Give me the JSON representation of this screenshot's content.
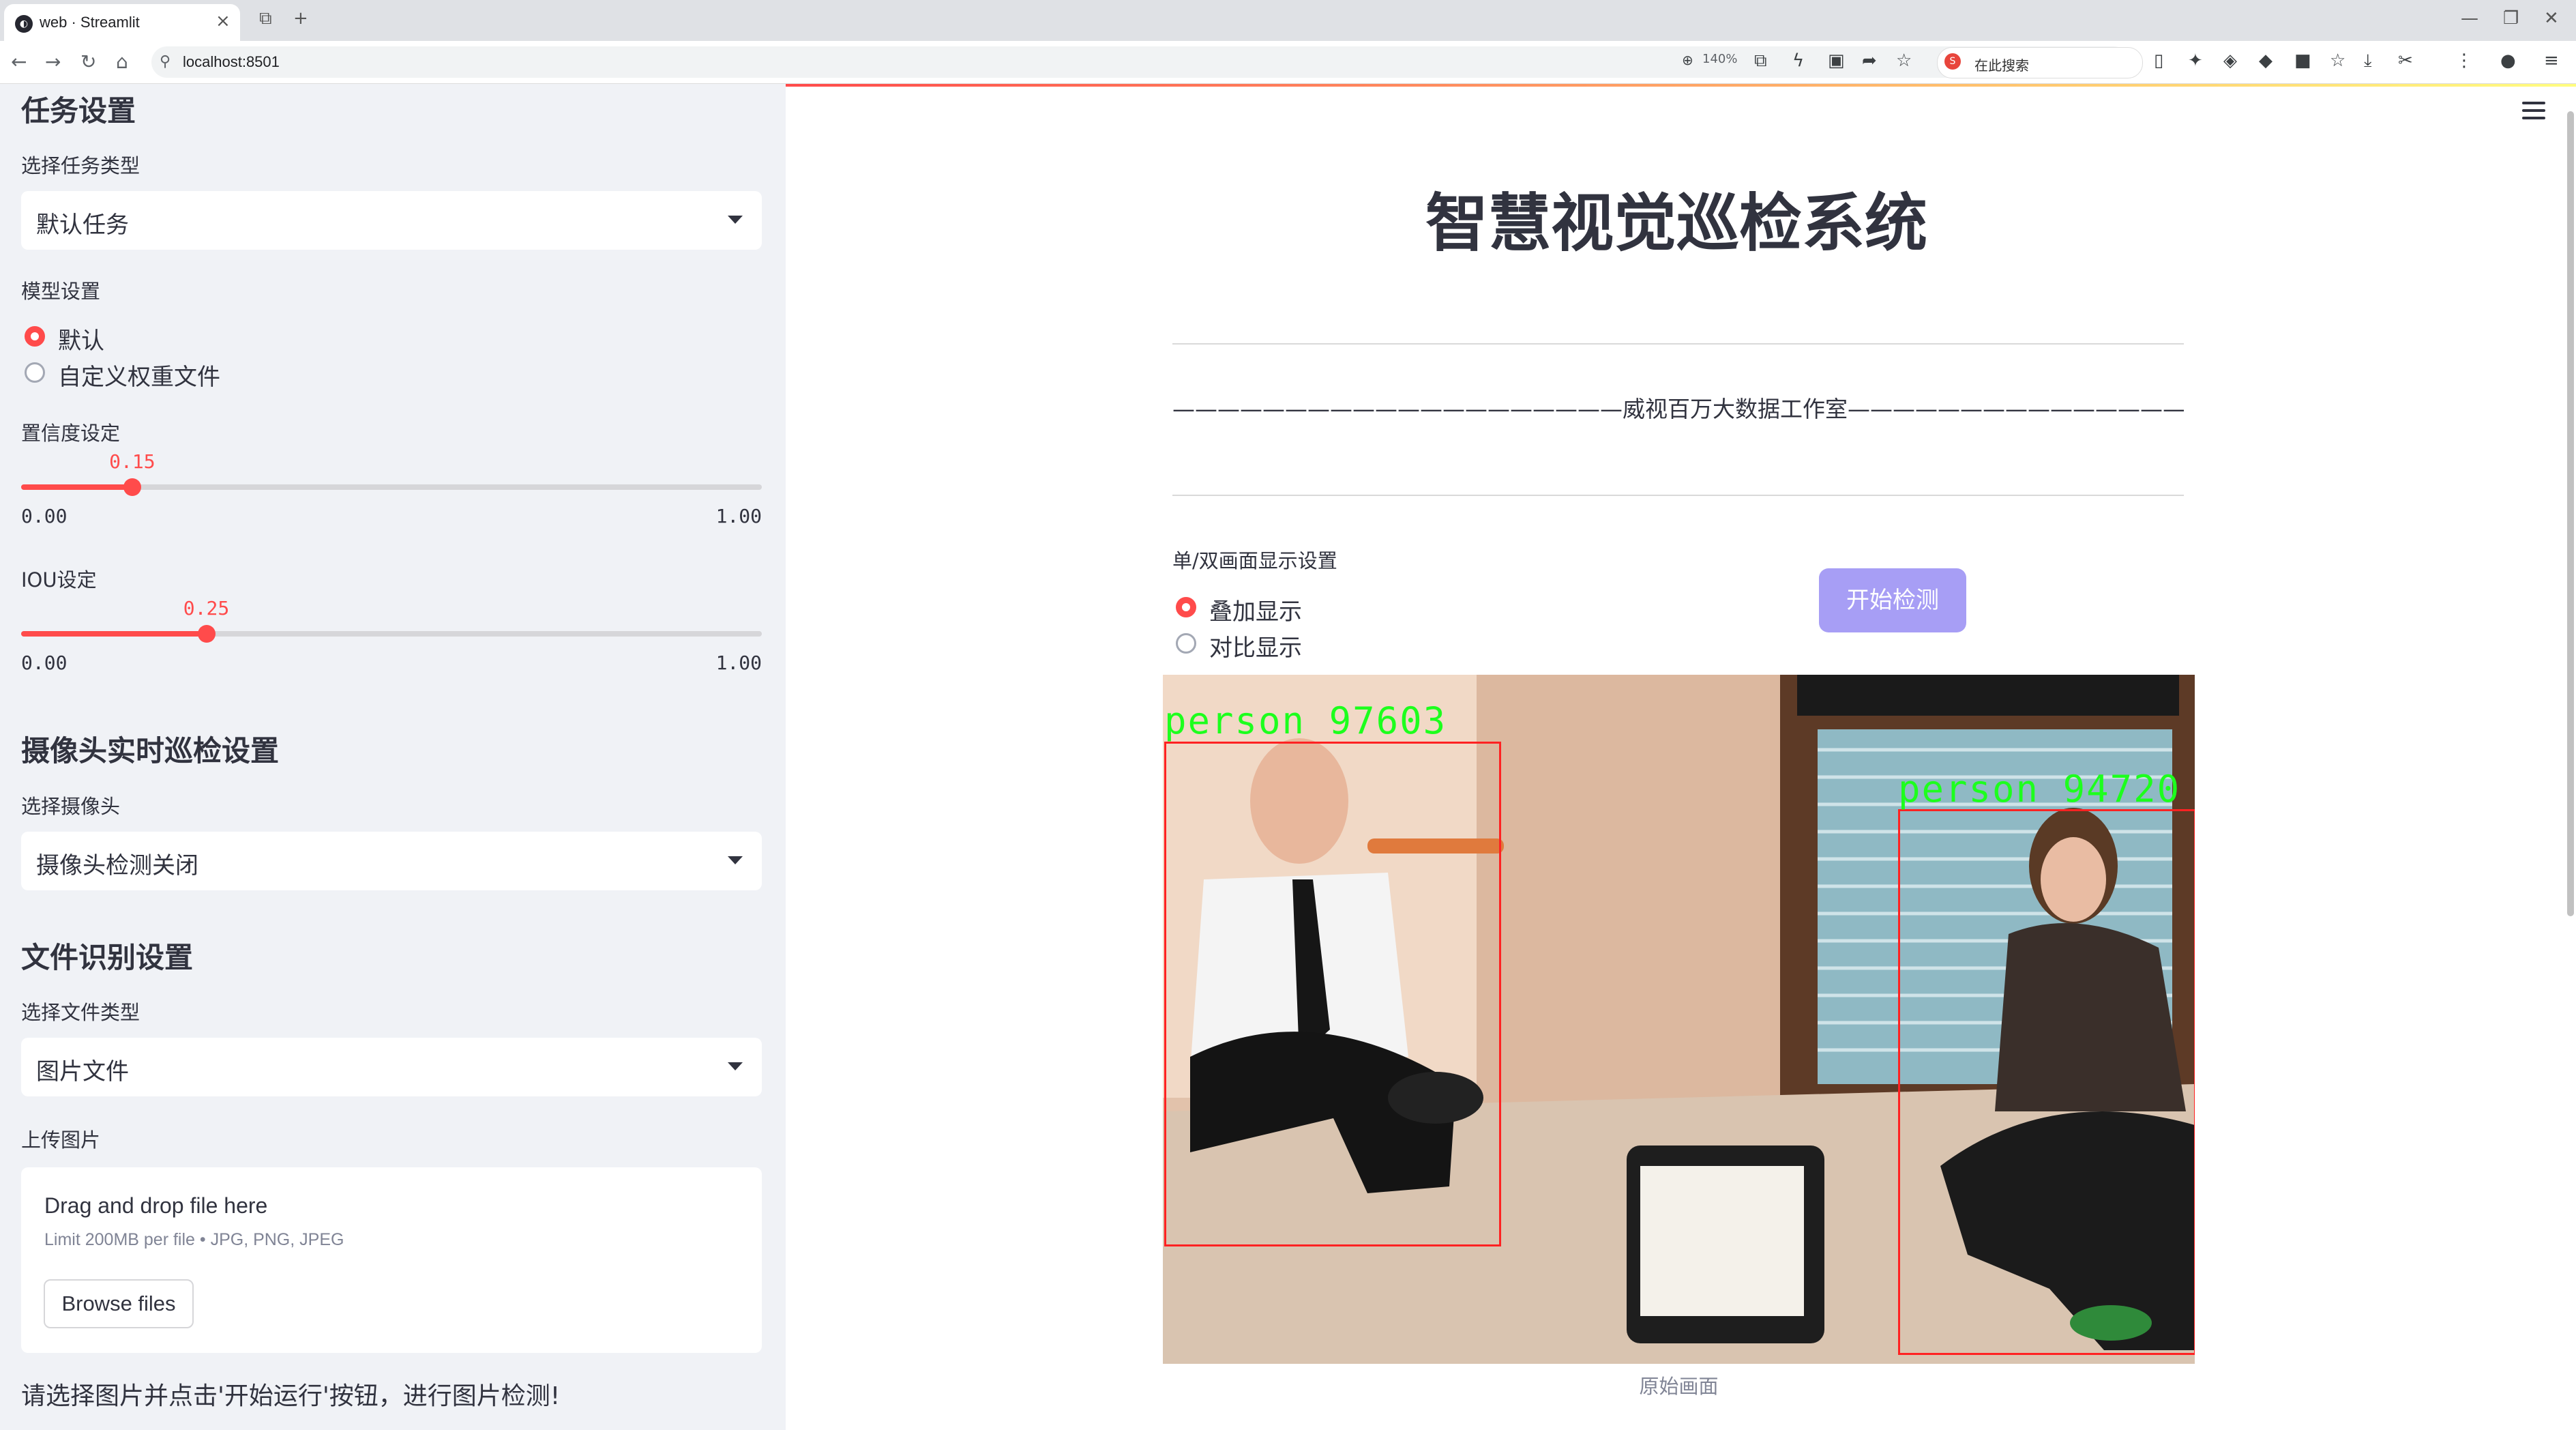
{
  "browser": {
    "tab_title": "web · Streamlit",
    "url": "localhost:8501",
    "zoom": "140%",
    "search_text": "在此搜索"
  },
  "sidebar": {
    "task_heading": "任务设置",
    "task_type_label": "选择任务类型",
    "task_type_value": "默认任务",
    "model_label": "模型设置",
    "model_options": [
      "默认",
      "自定义权重文件"
    ],
    "model_selected": "默认",
    "confidence": {
      "label": "置信度设定",
      "value": "0.15",
      "min": "0.00",
      "max": "1.00",
      "fraction": 0.15
    },
    "iou": {
      "label": "IOU设定",
      "value": "0.25",
      "min": "0.00",
      "max": "1.00",
      "fraction": 0.25
    },
    "camera_heading": "摄像头实时巡检设置",
    "camera_label": "选择摄像头",
    "camera_value": "摄像头检测关闭",
    "file_heading": "文件识别设置",
    "file_type_label": "选择文件类型",
    "file_type_value": "图片文件",
    "upload_label": "上传图片",
    "upload": {
      "drag_text": "Drag and drop file here",
      "limit_text": "Limit 200MB per file • JPG, PNG, JPEG",
      "browse_label": "Browse files"
    },
    "hint": "请选择图片并点击'开始运行'按钮，进行图片检测!"
  },
  "main": {
    "title": "智慧视觉巡检系统",
    "subtitle": "————————————————————威视百万大数据工作室—————————————————————",
    "display_label": "单/双画面显示设置",
    "display_options": [
      "叠加显示",
      "对比显示"
    ],
    "display_selected": "叠加显示",
    "start_button": "开始检测",
    "detections": [
      {
        "label": "person 97603"
      },
      {
        "label": "person 94720"
      }
    ],
    "caption": "原始画面"
  },
  "colors": {
    "accent": "#ff4b4b",
    "button": "#a79ef5",
    "detection_text": "#1dff1d",
    "detection_box": "#ff2222"
  }
}
